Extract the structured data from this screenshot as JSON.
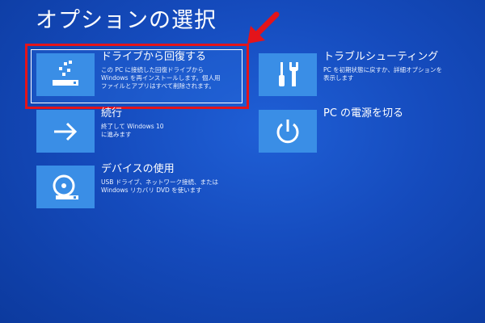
{
  "screen": {
    "title": "オプションの選択",
    "background_color": "#154bbd",
    "tile_color": "#3a8ee6",
    "highlight_color": "#e4141a"
  },
  "options": [
    {
      "title": "ドライブから回復する",
      "description": "この PC に接続した回復ドライブから\nWindows を再インストールします。個人用\nファイルとアプリはすべて削除されます。",
      "icon": "usb-drive-recovery-icon",
      "selected": true
    },
    {
      "title": "トラブルシューティング",
      "description": "PC を初期状態に戻すか、詳細オプションを\n表示します",
      "icon": "screwdriver-wrench-icon",
      "selected": false
    },
    {
      "title": "続行",
      "description": "終了して Windows 10\nに進みます",
      "icon": "arrow-right-icon",
      "selected": false
    },
    {
      "title": "PC の電源を切る",
      "description": "",
      "icon": "power-icon",
      "selected": false
    },
    {
      "title": "デバイスの使用",
      "description": "USB ドライブ、ネットワーク接続、または\nWindows リカバリ DVD を使います",
      "icon": "disc-drive-icon",
      "selected": false
    }
  ]
}
